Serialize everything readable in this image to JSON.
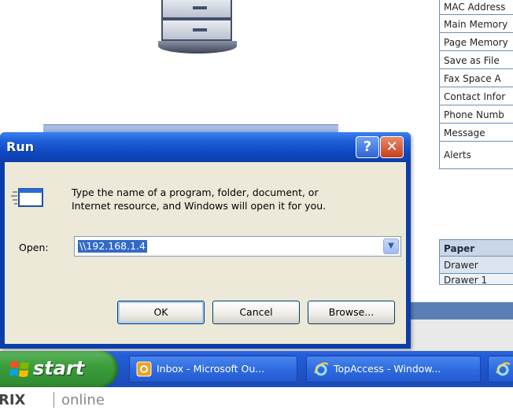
{
  "properties_table": {
    "rows": [
      "MAC Address",
      "Main Memory",
      "Page Memory",
      "Save as File",
      "Fax Space A",
      "Contact Infor",
      "Phone Numb",
      "Message",
      "Alerts"
    ]
  },
  "paper_table": {
    "header": "Paper",
    "sub": "Drawer",
    "item": "Drawer 1"
  },
  "run_dialog": {
    "title": "Run",
    "help_label": "?",
    "close_label": "✕",
    "description_line1": "Type the name of a program, folder, document, or",
    "description_line2": "Internet resource, and Windows will open it for you.",
    "open_label": "Open:",
    "open_value": "\\\\192.168.1.4",
    "dropdown_arrow": "▼",
    "ok_label": "OK",
    "cancel_label": "Cancel",
    "browse_label": "Browse..."
  },
  "taskbar": {
    "start_label": "start",
    "items": [
      {
        "label": "Inbox - Microsoft Ou...",
        "icon": "outlook-icon"
      },
      {
        "label": "TopAccess - Window...",
        "icon": "ie-icon"
      },
      {
        "label": "",
        "icon": "ie-icon"
      }
    ]
  },
  "footer": {
    "brand_bold": "RIX",
    "brand_light": "online"
  },
  "colors": {
    "xp_blue": "#0b3ea8",
    "start_green": "#3c9e3c",
    "selection_blue": "#316ac5",
    "dialog_face": "#ece9d8"
  }
}
